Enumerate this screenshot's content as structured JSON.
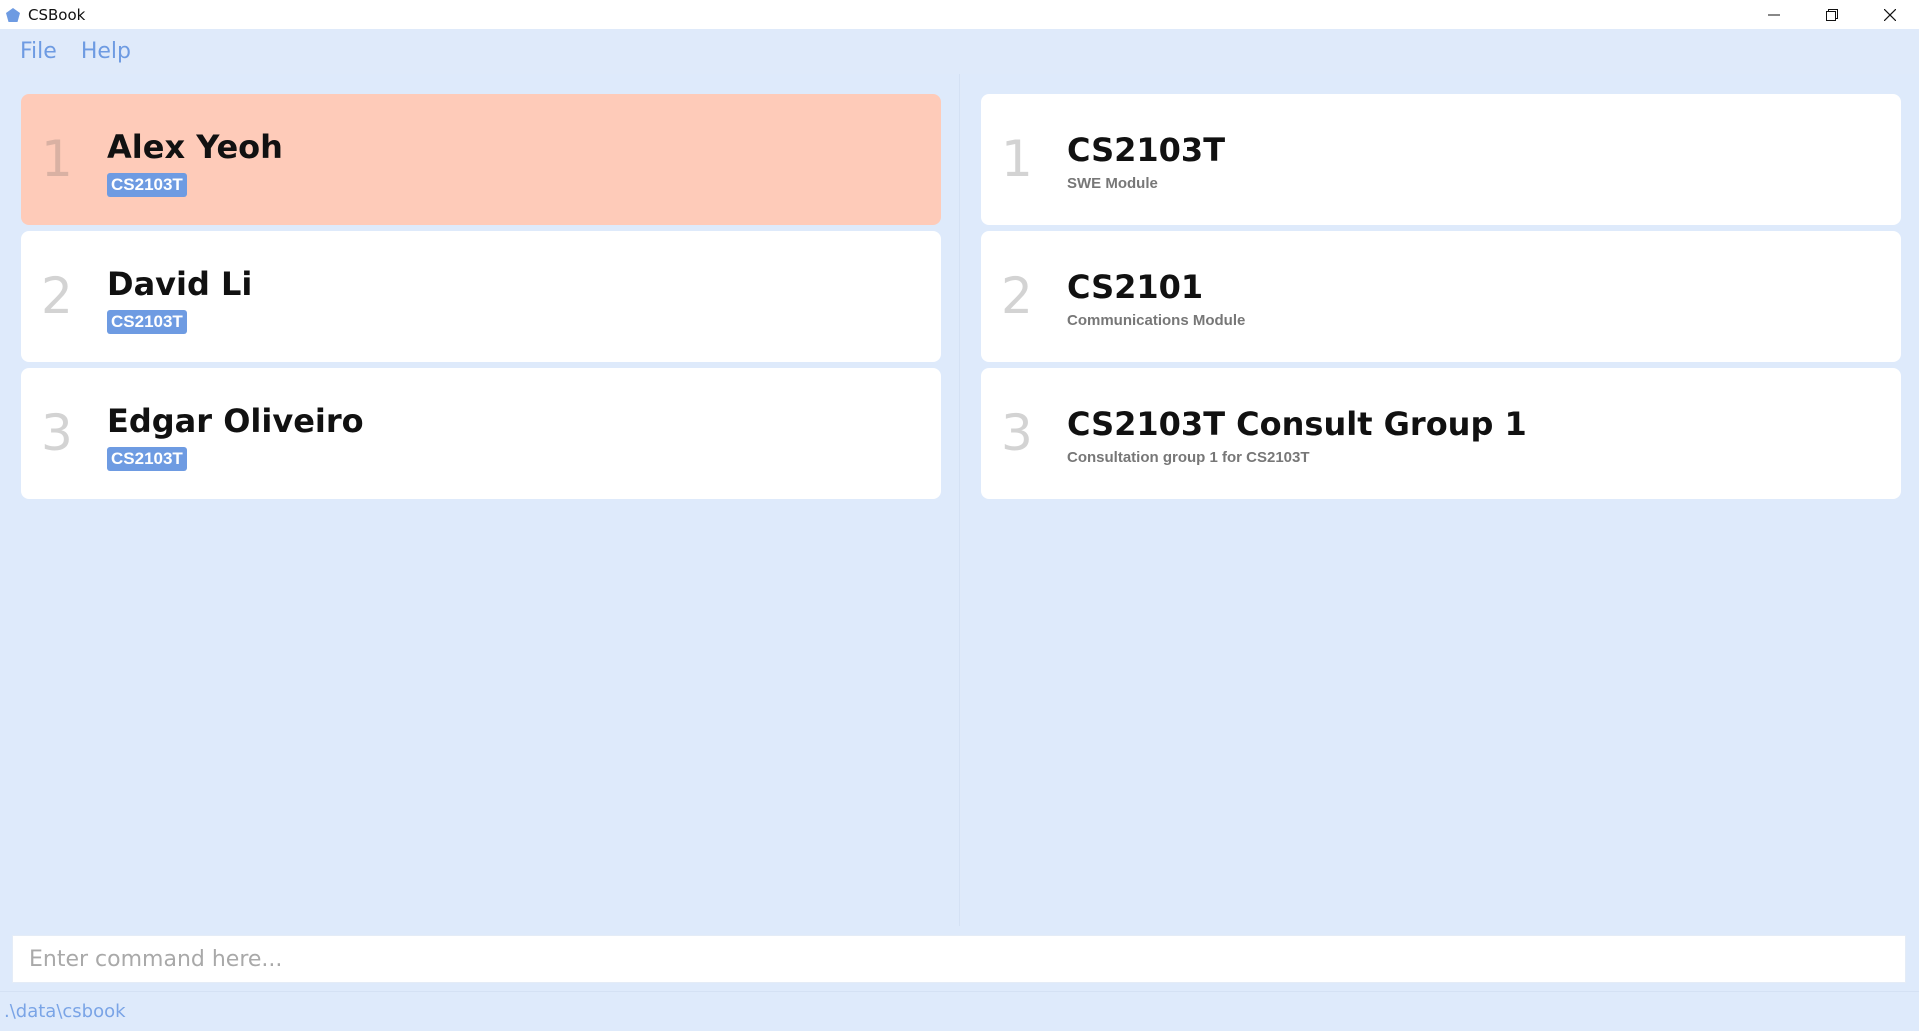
{
  "window": {
    "title": "CSBook"
  },
  "menu": {
    "items": [
      {
        "label": "File"
      },
      {
        "label": "Help"
      }
    ]
  },
  "persons": [
    {
      "index": "1",
      "name": "Alex Yeoh",
      "tag": "CS2103T",
      "selected": true
    },
    {
      "index": "2",
      "name": "David Li",
      "tag": "CS2103T",
      "selected": false
    },
    {
      "index": "3",
      "name": "Edgar Oliveiro",
      "tag": "CS2103T",
      "selected": false
    }
  ],
  "groups": [
    {
      "index": "1",
      "name": "CS2103T",
      "description": "SWE Module"
    },
    {
      "index": "2",
      "name": "CS2101",
      "description": "Communications Module"
    },
    {
      "index": "3",
      "name": "CS2103T Consult Group 1",
      "description": "Consultation group 1 for CS2103T"
    }
  ],
  "command": {
    "placeholder": "Enter command here...",
    "value": ""
  },
  "status": {
    "path": ".\\data\\csbook"
  },
  "colors": {
    "accent": "#6e9be2",
    "selected_card": "#fecbb9",
    "background": "#dfeafa"
  }
}
